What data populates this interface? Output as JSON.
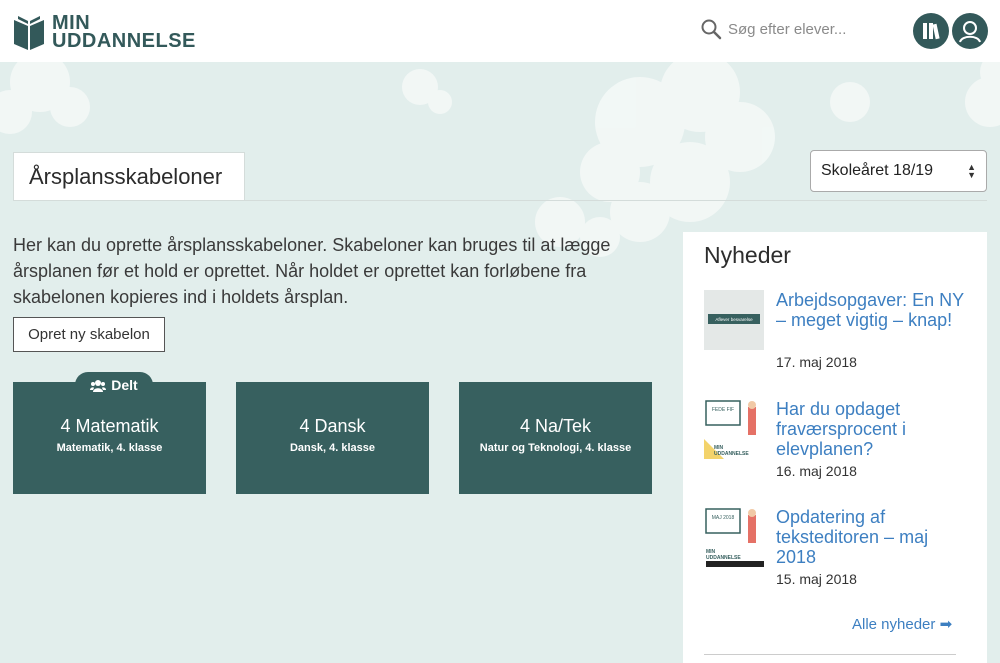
{
  "header": {
    "logo_line1": "MIN",
    "logo_line2": "UDDANNELSE",
    "search_placeholder": "Søg efter elever..."
  },
  "page": {
    "title": "Årsplansskabeloner",
    "intro": "Her kan du oprette årsplansskabeloner. Skabeloner kan bruges til at lægge årsplanen før et hold er oprettet. Når holdet er oprettet kan forløbene fra skabelonen kopieres ind i holdets årsplan.",
    "create_label": "Opret ny skabelon",
    "year_select": "Skoleåret 18/19"
  },
  "cards": [
    {
      "title": "4 Matematik",
      "subtitle": "Matematik, 4. klasse",
      "badge": "Delt"
    },
    {
      "title": "4 Dansk",
      "subtitle": "Dansk, 4. klasse"
    },
    {
      "title": "4 Na/Tek",
      "subtitle": "Natur og Teknologi, 4. klasse"
    }
  ],
  "news": {
    "heading": "Nyheder",
    "items": [
      {
        "title": "Arbejdsopgaver: En NY – meget vigtig – knap!",
        "date": "17. maj 2018",
        "thumb_text": "Afleveг besvarelse"
      },
      {
        "title": "Har du opdaget fraværsprocent i elevplanen?",
        "date": "16. maj 2018",
        "thumb_text": "FEDE FIF"
      },
      {
        "title": "Opdatering af teksteditoren – maj 2018",
        "date": "15. maj 2018",
        "thumb_text": "MAJ 2018"
      }
    ],
    "all_label": "Alle nyheder"
  },
  "colors": {
    "brand": "#37605f",
    "link": "#3d7fc1",
    "background": "#e2eeec"
  }
}
